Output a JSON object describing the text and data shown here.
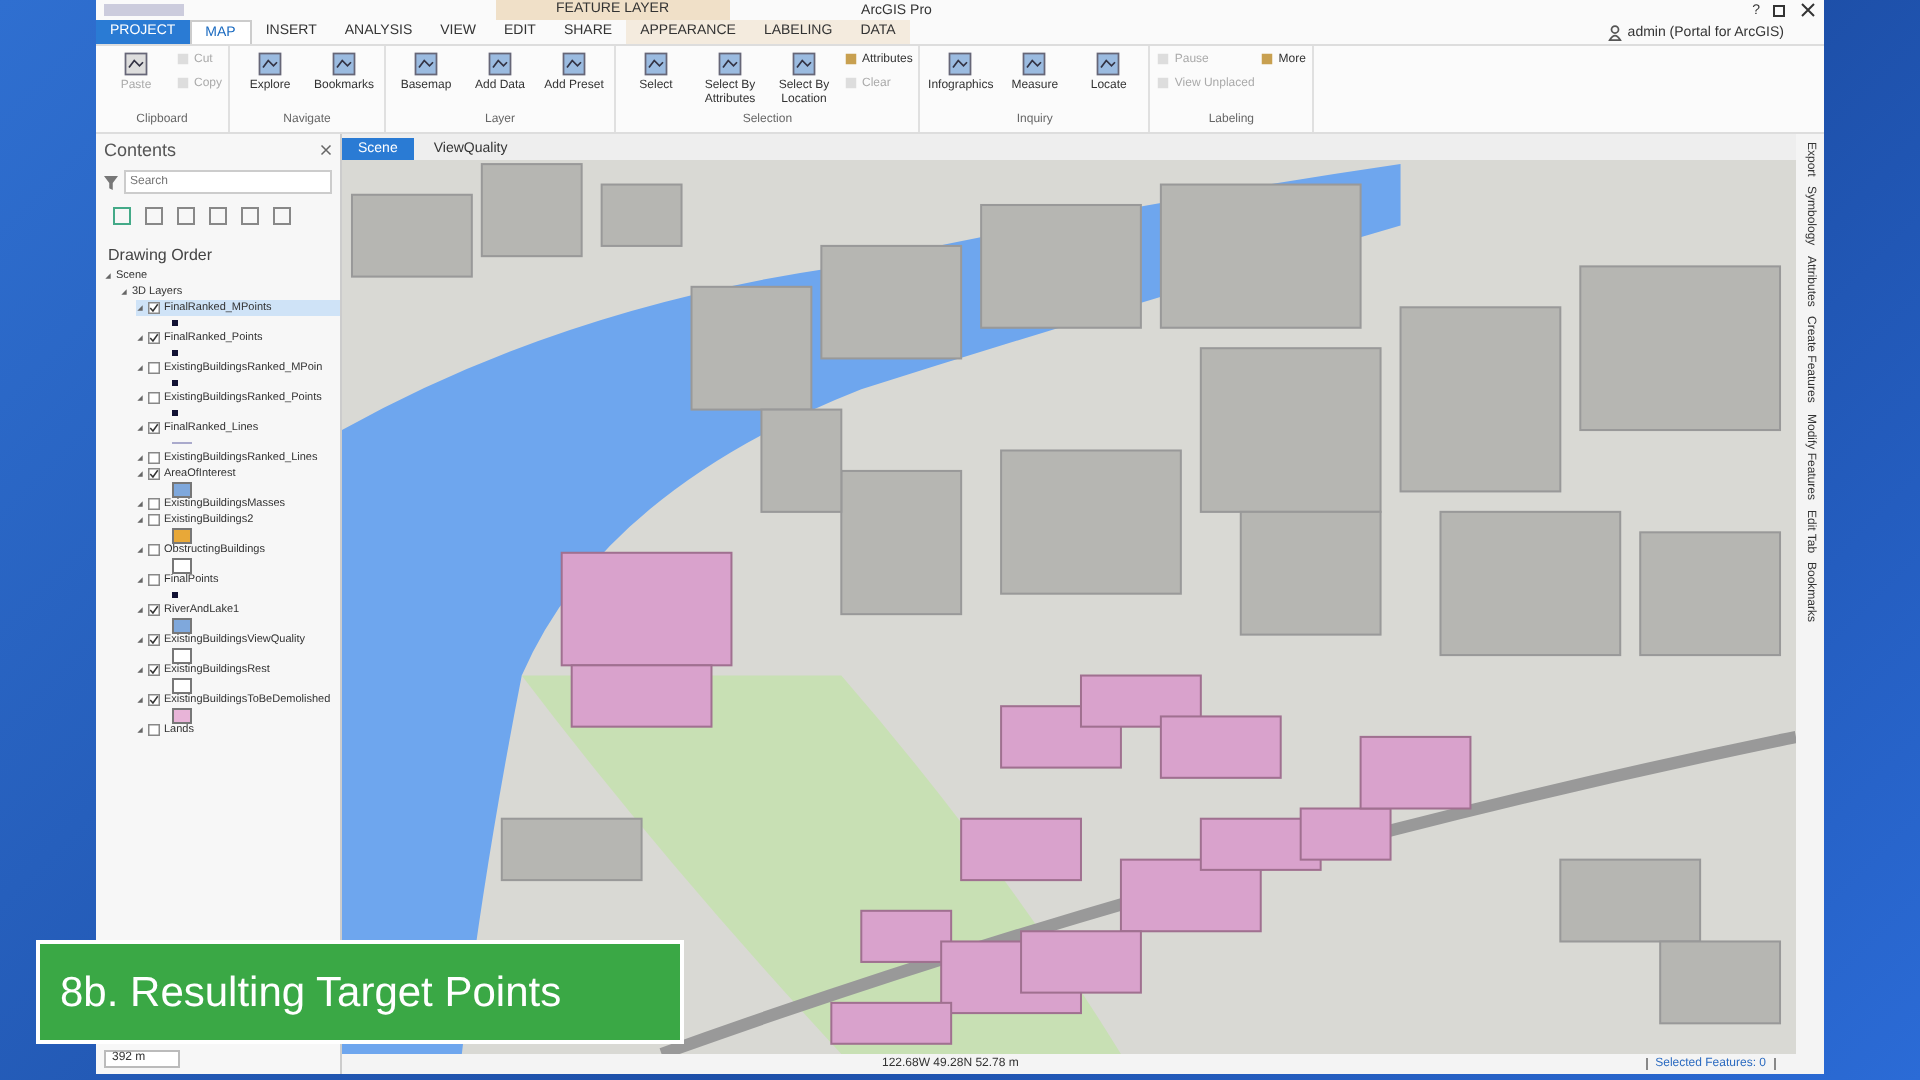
{
  "window": {
    "title": "ArcGIS Pro",
    "context_tab": "FEATURE LAYER",
    "help": "?",
    "user": "admin (Portal for ArcGIS)"
  },
  "tabs": [
    {
      "label": "PROJECT",
      "kind": "backstage",
      "selected": false
    },
    {
      "label": "MAP",
      "kind": "tab",
      "selected": true
    },
    {
      "label": "INSERT",
      "kind": "tab",
      "selected": false
    },
    {
      "label": "ANALYSIS",
      "kind": "tab",
      "selected": false
    },
    {
      "label": "VIEW",
      "kind": "tab",
      "selected": false
    },
    {
      "label": "EDIT",
      "kind": "tab",
      "selected": false
    },
    {
      "label": "SHARE",
      "kind": "tab",
      "selected": false
    },
    {
      "label": "APPEARANCE",
      "kind": "context",
      "selected": false
    },
    {
      "label": "LABELING",
      "kind": "context",
      "selected": false
    },
    {
      "label": "DATA",
      "kind": "context",
      "selected": false
    }
  ],
  "ribbon": [
    {
      "label": "Clipboard",
      "items": [
        {
          "label": "Paste",
          "kind": "large",
          "disabled": true
        },
        {
          "label": "Cut",
          "kind": "small",
          "disabled": true
        },
        {
          "label": "Copy",
          "kind": "small",
          "disabled": true
        }
      ]
    },
    {
      "label": "Navigate",
      "items": [
        {
          "label": "Explore",
          "kind": "large",
          "disabled": false
        },
        {
          "label": "Bookmarks",
          "kind": "large",
          "disabled": false
        }
      ]
    },
    {
      "label": "Layer",
      "items": [
        {
          "label": "Basemap",
          "kind": "large",
          "disabled": false
        },
        {
          "label": "Add Data",
          "kind": "large",
          "disabled": false
        },
        {
          "label": "Add Preset",
          "kind": "large",
          "disabled": false
        }
      ]
    },
    {
      "label": "Selection",
      "items": [
        {
          "label": "Select",
          "kind": "large",
          "disabled": false
        },
        {
          "label": "Select By Attributes",
          "kind": "large",
          "disabled": false
        },
        {
          "label": "Select By Location",
          "kind": "large",
          "disabled": false
        },
        {
          "label": "Attributes",
          "kind": "small",
          "disabled": false
        },
        {
          "label": "Clear",
          "kind": "small",
          "disabled": true
        }
      ]
    },
    {
      "label": "Inquiry",
      "items": [
        {
          "label": "Infographics",
          "kind": "large",
          "disabled": false
        },
        {
          "label": "Measure",
          "kind": "large",
          "disabled": false
        },
        {
          "label": "Locate",
          "kind": "large",
          "disabled": false
        }
      ]
    },
    {
      "label": "Labeling",
      "items": [
        {
          "label": "Pause",
          "kind": "small",
          "disabled": true
        },
        {
          "label": "View Unplaced",
          "kind": "small",
          "disabled": true
        },
        {
          "label": "More",
          "kind": "small",
          "disabled": false
        }
      ]
    }
  ],
  "contents": {
    "title": "Contents",
    "search": {
      "placeholder": "Search"
    },
    "heading": "Drawing Order",
    "tree": [
      {
        "name": "Scene",
        "expanded": true,
        "children": [
          {
            "name": "3D Layers",
            "expanded": true,
            "children": [
              {
                "name": "FinalRanked_MPoints",
                "checked": true,
                "selected": true,
                "kind": "point"
              },
              {
                "name": "FinalRanked_Points",
                "checked": true,
                "selected": false,
                "kind": "point"
              },
              {
                "name": "ExistingBuildingsRanked_MPoin",
                "checked": false,
                "selected": false,
                "kind": "point"
              },
              {
                "name": "ExistingBuildingsRanked_Points",
                "checked": false,
                "selected": false,
                "kind": "point"
              },
              {
                "name": "FinalRanked_Lines",
                "checked": true,
                "selected": false,
                "kind": "line"
              },
              {
                "name": "ExistingBuildingsRanked_Lines",
                "checked": false,
                "selected": false
              },
              {
                "name": "AreaOfInterest",
                "checked": true,
                "selected": false,
                "kind": "fill",
                "color": "#7fa8dc"
              },
              {
                "name": "ExistingBuildingsMasses",
                "checked": false,
                "selected": false
              },
              {
                "name": "ExistingBuildings2",
                "checked": false,
                "selected": false,
                "kind": "fill",
                "color": "#e8a838"
              },
              {
                "name": "ObstructingBuildings",
                "checked": false,
                "selected": false,
                "kind": "fill",
                "color": "#ffffff"
              },
              {
                "name": "FinalPoints",
                "checked": false,
                "selected": false,
                "kind": "point"
              },
              {
                "name": "RiverAndLake1",
                "checked": true,
                "selected": false,
                "kind": "fill",
                "color": "#7fa8dc"
              },
              {
                "name": "ExistingBuildingsViewQuality",
                "checked": true,
                "selected": false,
                "kind": "fill",
                "color": "#ffffff"
              },
              {
                "name": "ExistingBuildingsRest",
                "checked": true,
                "selected": false,
                "kind": "fill",
                "color": "#ffffff"
              },
              {
                "name": "ExistingBuildingsToBeDemolished",
                "checked": true,
                "selected": false,
                "kind": "fill",
                "color": "#e8b4d8"
              },
              {
                "name": "Lands",
                "checked": false,
                "selected": false
              }
            ]
          }
        ]
      }
    ]
  },
  "views": [
    {
      "label": "Scene",
      "selected": true
    },
    {
      "label": "ViewQuality",
      "selected": false
    }
  ],
  "dock": [
    "Export",
    "Symbology",
    "Attributes",
    "Create Features",
    "Modify Features",
    "Edit Tab",
    "Bookmarks"
  ],
  "status": {
    "scale": "392 m",
    "coordinates": "122.68W 49.28N 52.78 m",
    "selection": "Selected Features: 0"
  },
  "caption": "8b. Resulting Target Points"
}
